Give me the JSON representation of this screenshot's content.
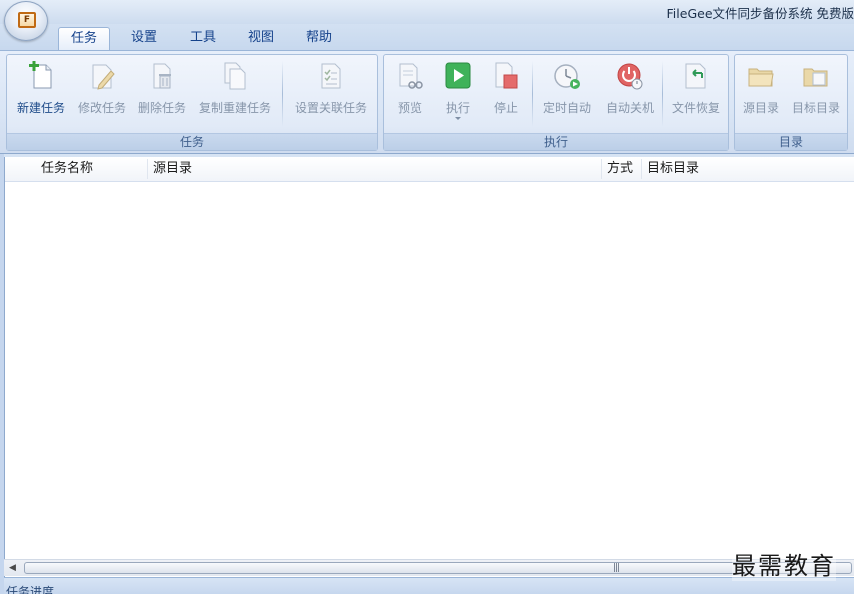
{
  "app": {
    "title": "FileGee文件同步备份系统 免费版",
    "orb_letter": "F"
  },
  "tabs": [
    "任务",
    "设置",
    "工具",
    "视图",
    "帮助"
  ],
  "active_tab": "任务",
  "ribbon": {
    "groups": [
      {
        "label": "任务",
        "buttons": [
          {
            "label": "新建任务",
            "icon": "new-task-icon",
            "enabled": true
          },
          {
            "label": "修改任务",
            "icon": "edit-task-icon",
            "enabled": false
          },
          {
            "label": "删除任务",
            "icon": "delete-task-icon",
            "enabled": false
          },
          {
            "label": "复制重建任务",
            "icon": "copy-task-icon",
            "enabled": false
          },
          {
            "label": "设置关联任务",
            "icon": "link-task-icon",
            "enabled": false
          }
        ]
      },
      {
        "label": "执行",
        "buttons": [
          {
            "label": "预览",
            "icon": "preview-icon",
            "enabled": false
          },
          {
            "label": "执行",
            "icon": "run-icon",
            "enabled": false
          },
          {
            "label": "停止",
            "icon": "stop-icon",
            "enabled": false
          },
          {
            "label": "定时自动",
            "icon": "timer-icon",
            "enabled": false
          },
          {
            "label": "自动关机",
            "icon": "power-icon",
            "enabled": false
          },
          {
            "label": "文件恢复",
            "icon": "restore-icon",
            "enabled": false
          }
        ]
      },
      {
        "label": "目录",
        "buttons": [
          {
            "label": "源目录",
            "icon": "source-folder-icon",
            "enabled": false
          },
          {
            "label": "目标目录",
            "icon": "target-folder-icon",
            "enabled": false
          }
        ]
      }
    ]
  },
  "table": {
    "columns": [
      "任务名称",
      "源目录",
      "方式",
      "目标目录"
    ],
    "rows": []
  },
  "status": {
    "progress_label": "任务进度"
  },
  "watermark": "最需教育",
  "colors": {
    "accent": "#15428b",
    "ribbon_bg": "#dfe9f5",
    "run_green": "#2fa84f",
    "stop_red": "#d9534f"
  }
}
